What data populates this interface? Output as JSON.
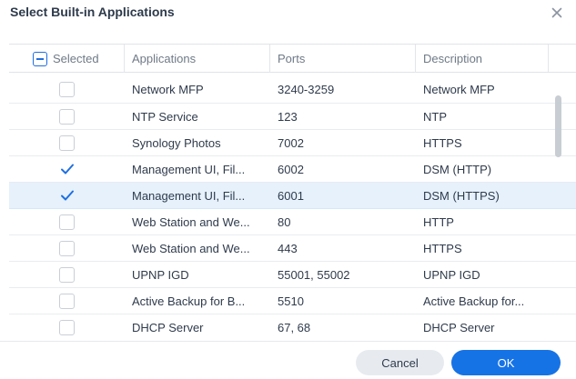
{
  "dialog": {
    "title": "Select Built-in Applications",
    "close_icon": "close-icon"
  },
  "table": {
    "headers": {
      "selected": "Selected",
      "applications": "Applications",
      "ports": "Ports",
      "description": "Description"
    },
    "header_checkbox_state": "partial",
    "rows": [
      {
        "app": "Network MFP",
        "ports": "3240-3259",
        "desc": "Network MFP",
        "checked": false
      },
      {
        "app": "NTP Service",
        "ports": "123",
        "desc": "NTP",
        "checked": false
      },
      {
        "app": "Synology Photos",
        "ports": "7002",
        "desc": "HTTPS",
        "checked": false
      },
      {
        "app": "Management UI, Fil...",
        "ports": "6002",
        "desc": "DSM (HTTP)",
        "checked": true
      },
      {
        "app": "Management UI, Fil...",
        "ports": "6001",
        "desc": "DSM (HTTPS)",
        "checked": true
      },
      {
        "app": "Web Station and We...",
        "ports": "80",
        "desc": "HTTP",
        "checked": false
      },
      {
        "app": "Web Station and We...",
        "ports": "443",
        "desc": "HTTPS",
        "checked": false
      },
      {
        "app": "UPNP IGD",
        "ports": "55001, 55002",
        "desc": "UPNP IGD",
        "checked": false
      },
      {
        "app": "Active Backup for B...",
        "ports": "5510",
        "desc": "Active Backup for...",
        "checked": false
      },
      {
        "app": "DHCP Server",
        "ports": "67, 68",
        "desc": "DHCP Server",
        "checked": false
      }
    ],
    "highlighted_row": 4
  },
  "footer": {
    "cancel_label": "Cancel",
    "ok_label": "OK"
  },
  "colors": {
    "accent": "#1673e6",
    "row_highlight": "#e6f1fc",
    "cancel_bg": "#e7ebf0"
  }
}
